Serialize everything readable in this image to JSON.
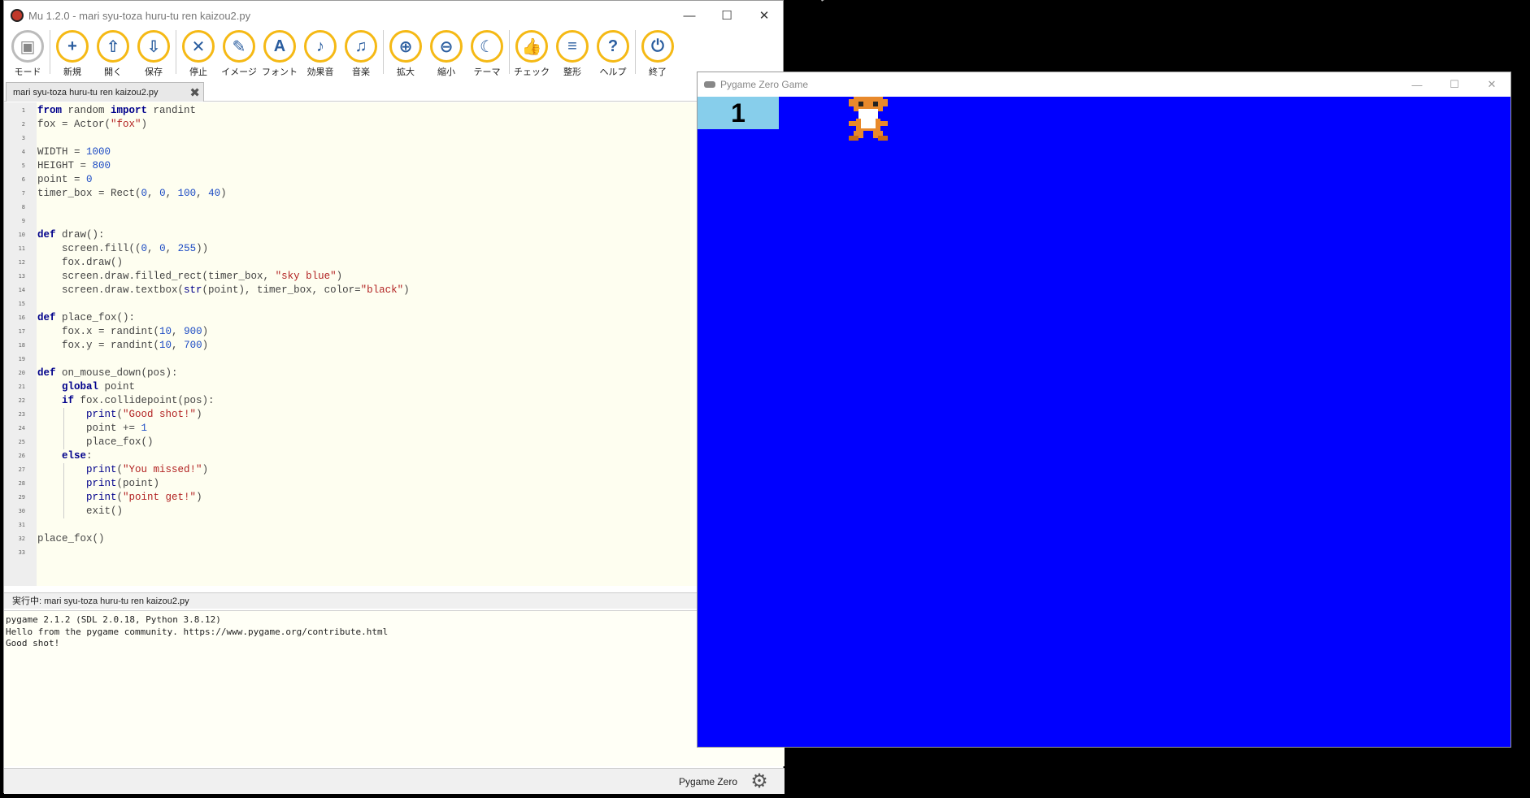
{
  "mu": {
    "title": "Mu 1.2.0 - mari syu-toza huru-tu ren kaizou2.py",
    "toolbar": [
      {
        "label": "モード",
        "icon": "mode-icon",
        "glyph": "▣",
        "grey": true
      },
      {
        "label": "新規",
        "icon": "new-icon",
        "glyph": "+"
      },
      {
        "label": "開く",
        "icon": "open-icon",
        "glyph": "⇧"
      },
      {
        "label": "保存",
        "icon": "save-icon",
        "glyph": "⇩"
      },
      {
        "label": "停止",
        "icon": "stop-icon",
        "glyph": "✕"
      },
      {
        "label": "イメージ",
        "icon": "images-icon",
        "glyph": "✎"
      },
      {
        "label": "フォント",
        "icon": "fonts-icon",
        "glyph": "A"
      },
      {
        "label": "効果音",
        "icon": "sounds-icon",
        "glyph": "♪"
      },
      {
        "label": "音楽",
        "icon": "music-icon",
        "glyph": "♫"
      },
      {
        "label": "拡大",
        "icon": "zoom-in-icon",
        "glyph": "⊕"
      },
      {
        "label": "縮小",
        "icon": "zoom-out-icon",
        "glyph": "⊖"
      },
      {
        "label": "テーマ",
        "icon": "theme-icon",
        "glyph": "☾"
      },
      {
        "label": "チェック",
        "icon": "check-icon",
        "glyph": "👍"
      },
      {
        "label": "整形",
        "icon": "tidy-icon",
        "glyph": "≡"
      },
      {
        "label": "ヘルプ",
        "icon": "help-icon",
        "glyph": "?"
      },
      {
        "label": "終了",
        "icon": "quit-icon",
        "glyph": "⏻"
      }
    ],
    "tab_label": "mari syu-toza huru-tu ren kaizou2.py",
    "code_lines": [
      "from random import randint",
      "fox = Actor(\"fox\")",
      "",
      "WIDTH = 1000",
      "HEIGHT = 800",
      "point = 0",
      "timer_box = Rect(0, 0, 100, 40)",
      "",
      "",
      "def draw():",
      "    screen.fill((0, 0, 255))",
      "    fox.draw()",
      "    screen.draw.filled_rect(timer_box, \"sky blue\")",
      "    screen.draw.textbox(str(point), timer_box, color=\"black\")",
      "",
      "def place_fox():",
      "    fox.x = randint(10, 900)",
      "    fox.y = randint(10, 700)",
      "",
      "def on_mouse_down(pos):",
      "    global point",
      "    if fox.collidepoint(pos):",
      "        print(\"Good shot!\")",
      "        point += 1",
      "        place_fox()",
      "    else:",
      "        print(\"You missed!\")",
      "        print(point)",
      "        print(\"point get!\")",
      "        exit()",
      "",
      "place_fox()",
      ""
    ],
    "status_text": "実行中: mari syu-toza huru-tu ren kaizou2.py",
    "repl_output": "pygame 2.1.2 (SDL 2.0.18, Python 3.8.12)\nHello from the pygame community. https://www.pygame.org/contribute.html\nGood shot!",
    "mode_label": "Pygame Zero"
  },
  "pygame": {
    "title": "Pygame Zero Game",
    "score": "1",
    "background_color": "#0000ff",
    "score_box_color": "#87ceeb"
  }
}
